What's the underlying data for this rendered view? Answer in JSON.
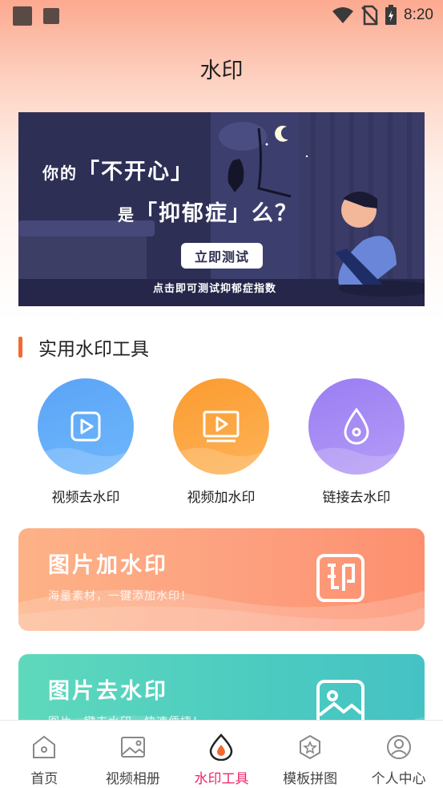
{
  "status_bar": {
    "time": "8:20"
  },
  "header": {
    "title": "水印"
  },
  "banner": {
    "line1_prefix": "你的",
    "line1_highlight": "「不开心」",
    "line2_prefix": "是",
    "line2_highlight": "「抑郁症」么？",
    "button_label": "立即测试",
    "subtitle": "点击即可测试抑郁症指数"
  },
  "section": {
    "title": "实用水印工具"
  },
  "tools": [
    {
      "label": "视频去水印",
      "icon": "play-square-icon"
    },
    {
      "label": "视频加水印",
      "icon": "video-play-icon"
    },
    {
      "label": "链接去水印",
      "icon": "drop-icon"
    }
  ],
  "cards": [
    {
      "title": "图片加水印",
      "subtitle": "海量素材，一键添加水印！",
      "icon": "印"
    },
    {
      "title": "图片去水印",
      "subtitle": "图片一键去水印，快速便捷！"
    }
  ],
  "tabbar": [
    {
      "label": "首页",
      "icon": "home-icon",
      "active": false
    },
    {
      "label": "视频相册",
      "icon": "image-icon",
      "active": false
    },
    {
      "label": "水印工具",
      "icon": "water-drop-icon",
      "active": true
    },
    {
      "label": "模板拼图",
      "icon": "star-hexagon-icon",
      "active": false
    },
    {
      "label": "个人中心",
      "icon": "user-icon",
      "active": false
    }
  ],
  "colors": {
    "accent": "#f0246a",
    "section_bar": "#f26a2e"
  }
}
